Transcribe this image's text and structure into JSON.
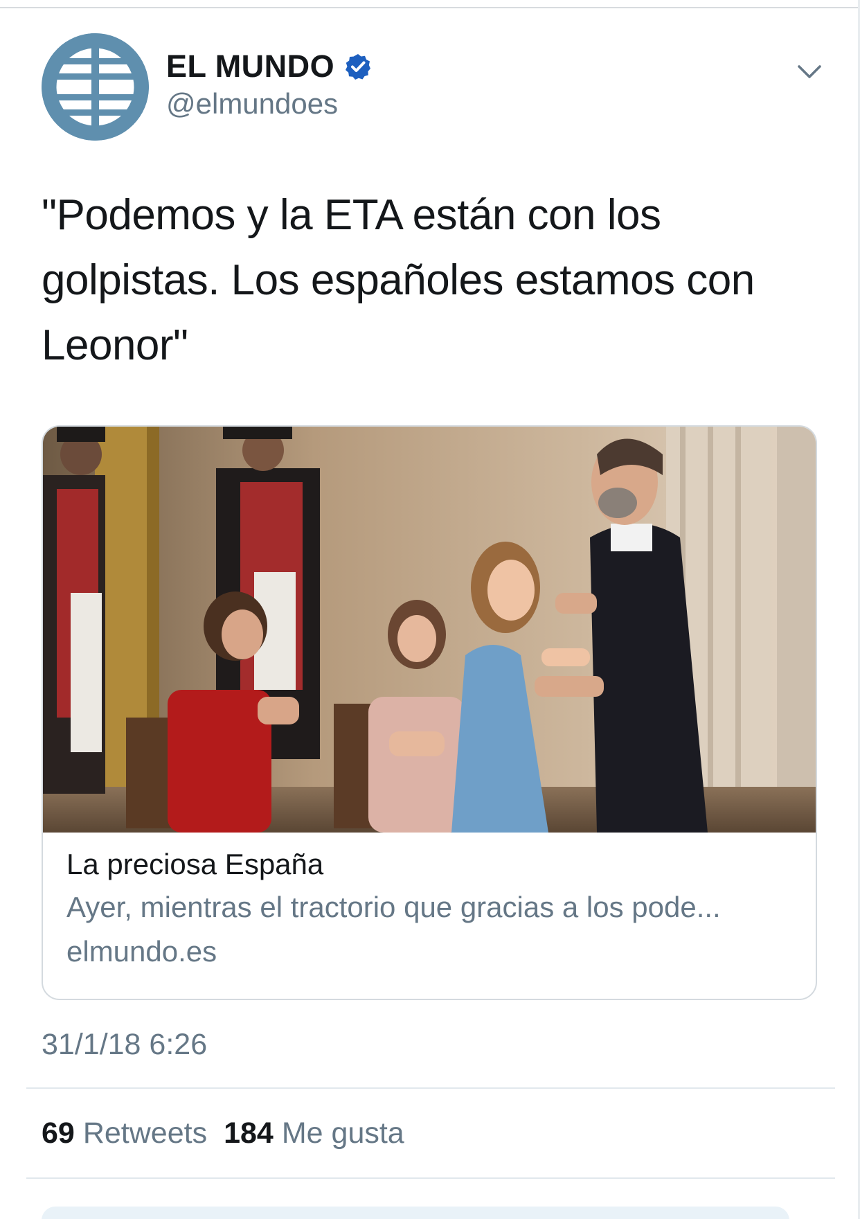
{
  "account": {
    "display_name": "EL MUNDO",
    "handle": "@elmundoes",
    "verified": true,
    "avatar_color": "#5f8fae",
    "verified_color": "#1da1f2"
  },
  "tweet": {
    "text_lines": [
      "\"Podemos y la ETA están con los",
      "golpistas. Los españoles estamos con",
      "Leonor\""
    ],
    "timestamp": "31/1/18 6:26"
  },
  "card": {
    "image_icon": "photo",
    "title": "La preciosa España",
    "description": "Ayer, mientras el tractorio que gracias a los pode...",
    "domain": "elmundo.es"
  },
  "stats": {
    "retweets_count": "69",
    "retweets_label": "Retweets",
    "likes_count": "184",
    "likes_label": "Me gusta"
  },
  "icons": {
    "menu": "chevron-down-icon",
    "verified": "verified-badge-icon"
  }
}
